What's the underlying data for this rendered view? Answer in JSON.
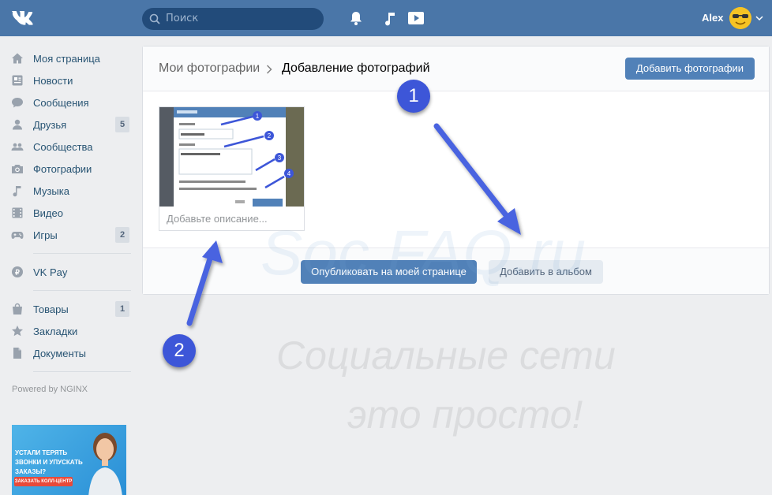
{
  "header": {
    "search_placeholder": "Поиск",
    "user_name": "Alex"
  },
  "sidebar": {
    "items": [
      {
        "label": "Моя страница",
        "icon": "home-icon"
      },
      {
        "label": "Новости",
        "icon": "news-icon"
      },
      {
        "label": "Сообщения",
        "icon": "messages-icon"
      },
      {
        "label": "Друзья",
        "icon": "friends-icon",
        "badge": "5"
      },
      {
        "label": "Сообщества",
        "icon": "groups-icon"
      },
      {
        "label": "Фотографии",
        "icon": "camera-icon"
      },
      {
        "label": "Музыка",
        "icon": "music-icon"
      },
      {
        "label": "Видео",
        "icon": "video-icon"
      },
      {
        "label": "Игры",
        "icon": "gamepad-icon",
        "badge": "2"
      },
      {
        "label": "VK Pay",
        "icon": "vkpay-icon"
      },
      {
        "label": "Товары",
        "icon": "bag-icon",
        "badge": "1"
      },
      {
        "label": "Закладки",
        "icon": "star-icon"
      },
      {
        "label": "Документы",
        "icon": "document-icon"
      }
    ],
    "powered": "Powered by NGINX"
  },
  "ad": {
    "text": "УСТАЛИ ТЕРЯТЬ ЗВОНКИ И УПУСКАТЬ ЗАКАЗЫ?",
    "button": "ЗАКАЗАТЬ КОЛЛ-ЦЕНТР"
  },
  "main": {
    "breadcrumb_parent": "Мои фотографии",
    "breadcrumb_current": "Добавление фотографий",
    "add_photos_button": "Добавить фотографии",
    "description_placeholder": "Добавьте описание...",
    "publish_button": "Опубликовать на моей странице",
    "add_to_album_button": "Добавить в альбом"
  },
  "watermark": {
    "site": "Soc FAQ.ru",
    "line1": "Социальные сети",
    "line2": "это просто!"
  },
  "annotations": {
    "marker1": "1",
    "marker2": "2"
  },
  "colors": {
    "header": "#4a76a8",
    "primary_button": "#5181b8",
    "annotation": "#3d56d8"
  }
}
